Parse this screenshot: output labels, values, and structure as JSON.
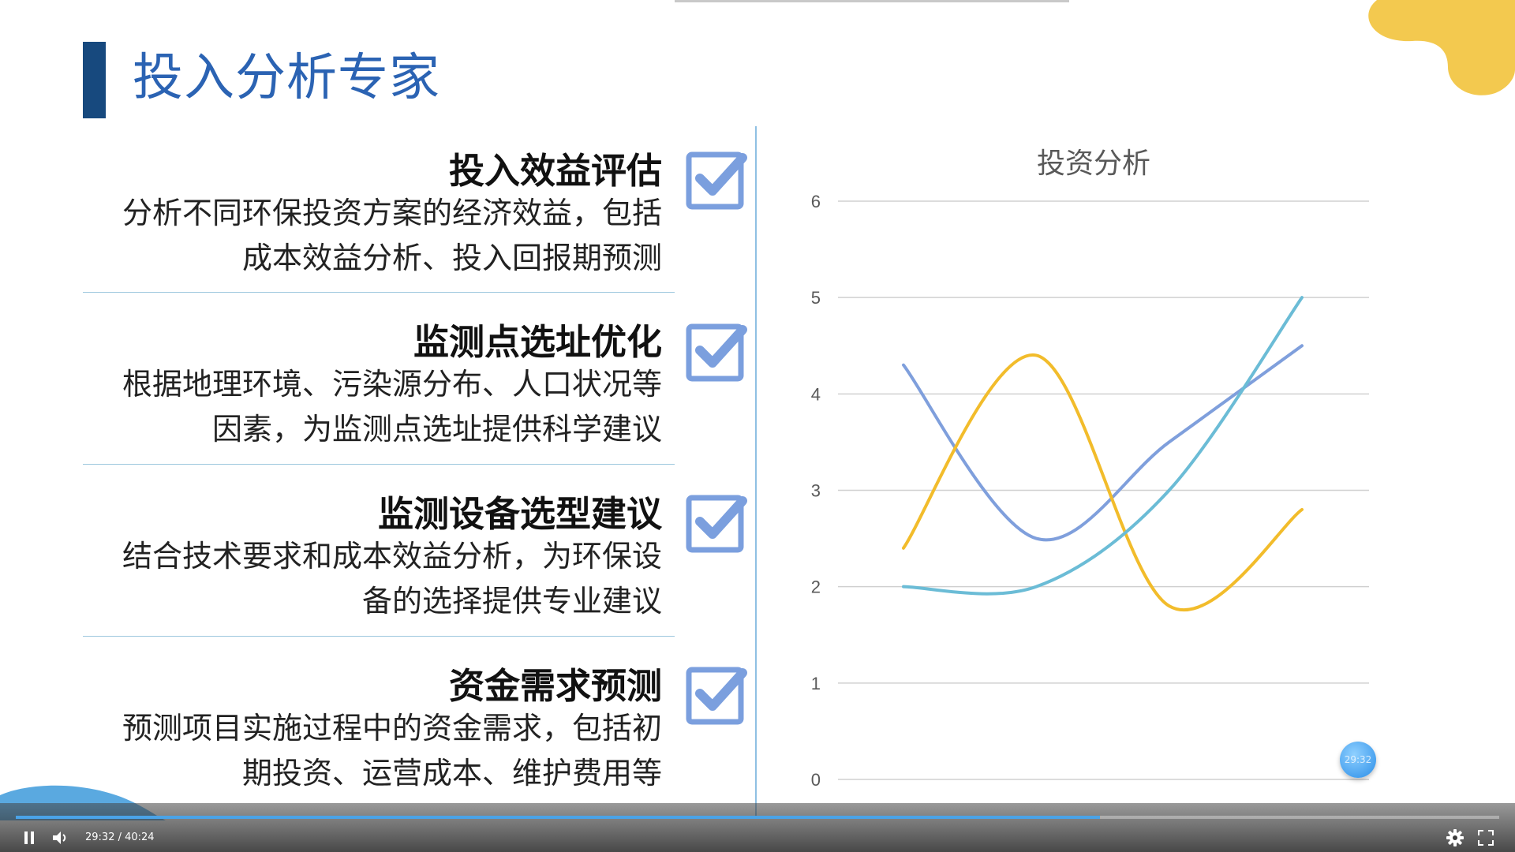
{
  "slide": {
    "title": "投入分析专家",
    "items": [
      {
        "heading": "投入效益评估",
        "body": "分析不同环保投资方案的经济效益，包括成本效益分析、投入回报期预测"
      },
      {
        "heading": "监测点选址优化",
        "body": "根据地理环境、污染源分布、人口状况等因素，为监测点选址提供科学建议"
      },
      {
        "heading": "监测设备选型建议",
        "body": "结合技术要求和成本效益分析，为环保设备的选择提供专业建议"
      },
      {
        "heading": "资金需求预测",
        "body": "预测项目实施过程中的资金需求，包括初期投资、运营成本、维护费用等"
      }
    ]
  },
  "chart_data": {
    "type": "line",
    "title": "投资分析",
    "xlabel": "",
    "ylabel": "",
    "ylim": [
      0,
      6
    ],
    "yticks": [
      "0",
      "1",
      "2",
      "3",
      "4",
      "5",
      "6"
    ],
    "x": [
      1,
      2,
      3,
      4
    ],
    "smooth": true,
    "grid": true,
    "series": [
      {
        "values": [
          4.3,
          2.5,
          3.5,
          4.5
        ],
        "color": "#7f9fdc"
      },
      {
        "values": [
          2.4,
          4.4,
          1.8,
          2.8
        ],
        "color": "#f2bc2b"
      },
      {
        "values": [
          2.0,
          2.0,
          3.0,
          5.0
        ],
        "color": "#6bbcd6"
      }
    ]
  },
  "player": {
    "time_display": "29:32 / 40:24",
    "bubble_time": "29:32",
    "progress": 0.731,
    "play_icon": "pause-icon",
    "volume_icon": "volume-icon",
    "settings_icon": "gear-icon",
    "fullscreen_icon": "fullscreen-icon"
  },
  "colors": {
    "title": "#2b63b3",
    "title_bar": "#17497e",
    "checkbox": "#7b9fde",
    "accent_blob": "#f3c94f",
    "progress": "#4aa3e8"
  }
}
